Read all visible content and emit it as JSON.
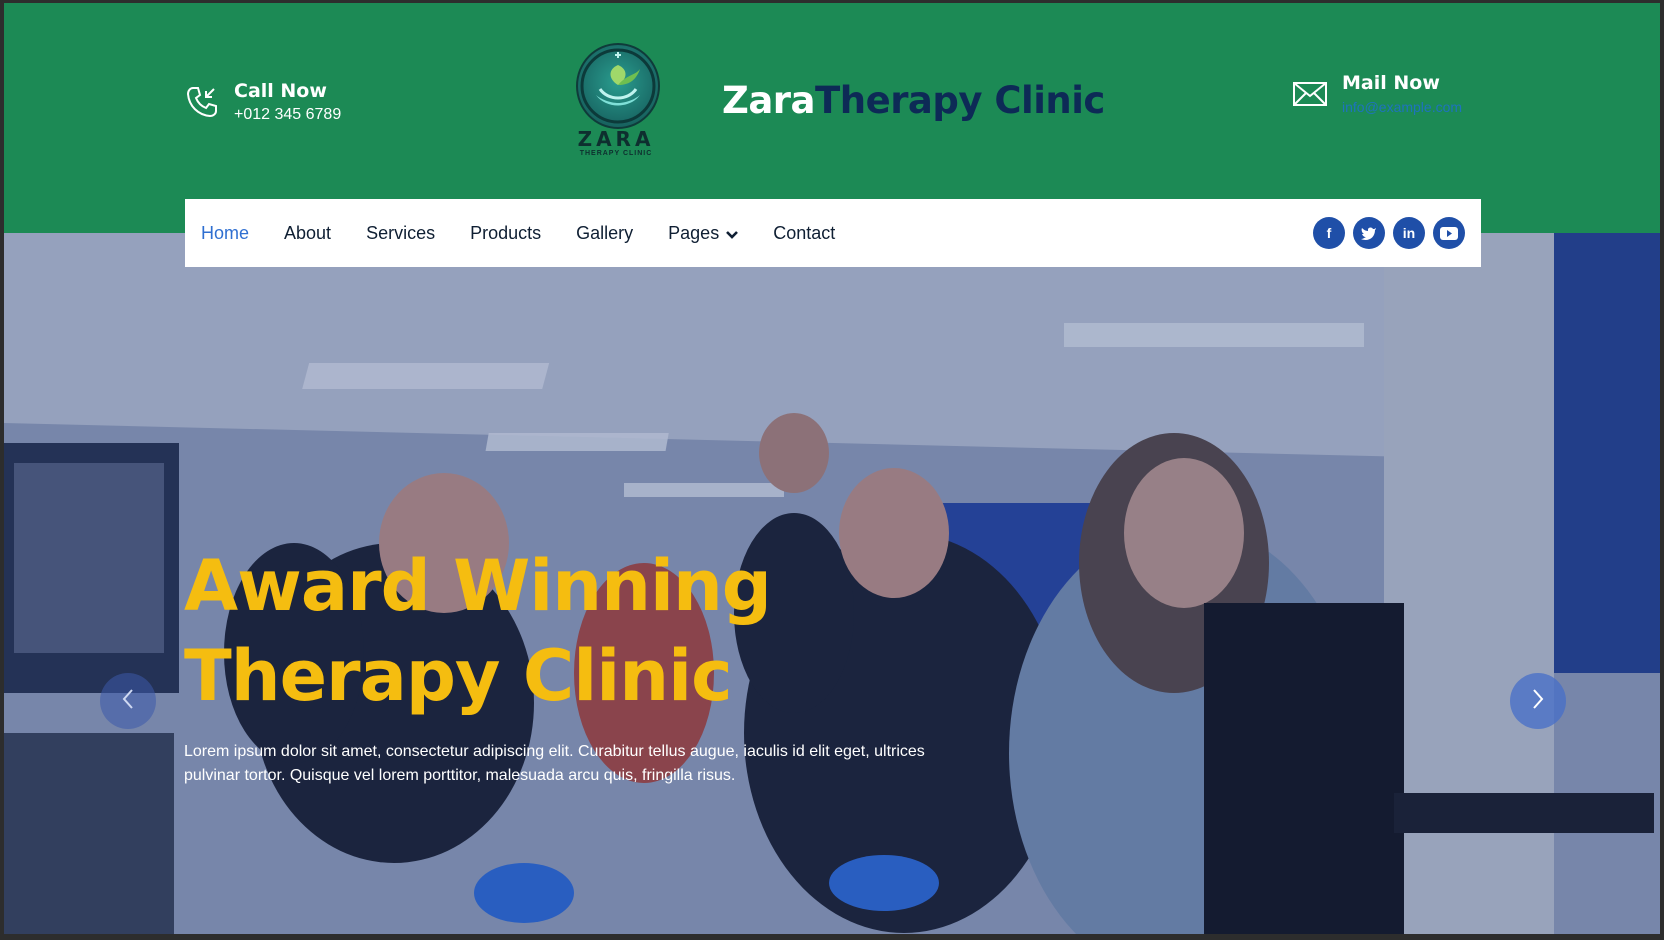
{
  "header": {
    "call": {
      "label": "Call Now",
      "value": "+012 345 6789",
      "icon": "phone-icon"
    },
    "mail": {
      "label": "Mail Now",
      "value": "info@example.com",
      "icon": "envelope-icon"
    },
    "logo": {
      "name": "ZARA",
      "tagline": "THERAPY CLINIC"
    },
    "brand": {
      "first": "Zara",
      "second": "Therapy Clinic"
    }
  },
  "nav": {
    "items": [
      {
        "label": "Home",
        "active": true
      },
      {
        "label": "About"
      },
      {
        "label": "Services"
      },
      {
        "label": "Products"
      },
      {
        "label": "Gallery"
      },
      {
        "label": "Pages",
        "dropdown": true
      },
      {
        "label": "Contact"
      }
    ],
    "social": [
      {
        "name": "facebook-icon",
        "glyph": "f"
      },
      {
        "name": "twitter-icon",
        "glyph": "t"
      },
      {
        "name": "linkedin-icon",
        "glyph": "in"
      },
      {
        "name": "youtube-icon",
        "glyph": "▶"
      }
    ]
  },
  "hero": {
    "title_line1": "Award Winning",
    "title_line2": "Therapy Clinic",
    "text": "Lorem ipsum dolor sit amet, consectetur adipiscing elit. Curabitur tellus augue, iaculis id elit eget, ultrices pulvinar tortor. Quisque vel lorem porttitor, malesuada arcu quis, fringilla risus."
  },
  "colors": {
    "header_bg": "#1c8a55",
    "brand_dark": "#0d2a56",
    "title_yellow": "#f5bd10",
    "nav_active": "#2f6fd1",
    "social_bg": "#1f4fa8"
  }
}
